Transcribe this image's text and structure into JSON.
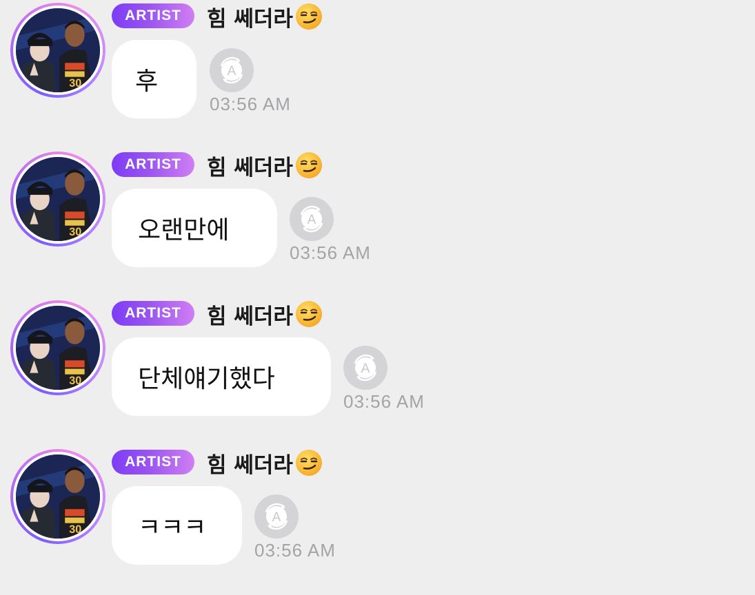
{
  "messages": [
    {
      "badge": "ARTIST",
      "sender_name": "힘 쎄더라",
      "sender_emoji": "smirking-face-emoji",
      "text": "후",
      "time": "03:56 AM",
      "translate_icon": "translate-icon"
    },
    {
      "badge": "ARTIST",
      "sender_name": "힘 쎄더라",
      "sender_emoji": "smirking-face-emoji",
      "text": "오랜만에",
      "time": "03:56 AM",
      "translate_icon": "translate-icon"
    },
    {
      "badge": "ARTIST",
      "sender_name": "힘 쎄더라",
      "sender_emoji": "smirking-face-emoji",
      "text": "단체얘기했다",
      "time": "03:56 AM",
      "translate_icon": "translate-icon"
    },
    {
      "badge": "ARTIST",
      "sender_name": "힘 쎄더라",
      "sender_emoji": "smirking-face-emoji",
      "text": "ㅋㅋㅋ",
      "time": "03:56 AM",
      "translate_icon": "translate-icon"
    }
  ],
  "colors": {
    "background": "#eeeeef",
    "bubble": "#ffffff",
    "badge_start": "#7d3cf5",
    "badge_end": "#d07ef2",
    "timestamp": "#a4a4a7",
    "translate_button": "#d4d4d6"
  }
}
